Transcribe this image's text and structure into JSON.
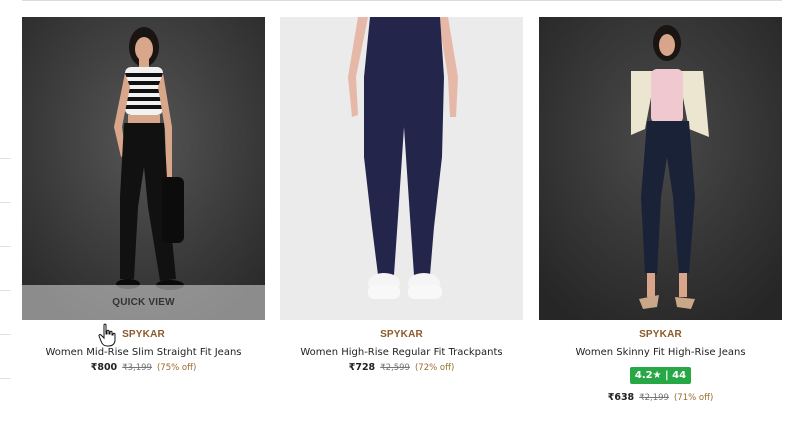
{
  "products": [
    {
      "brand": "SPYKAR",
      "title": "Women Mid-Rise Slim Straight Fit Jeans",
      "price": "₹800",
      "mrp": "₹3,199",
      "discount": "(75% off)",
      "quick_view": "QUICK VIEW",
      "colors": {
        "bg": "#3a3a3a",
        "top": "#f2f2f2",
        "bottom": "#111111"
      }
    },
    {
      "brand": "SPYKAR",
      "title": "Women High-Rise Regular Fit Trackpants",
      "price": "₹728",
      "mrp": "₹2,599",
      "discount": "(72% off)",
      "colors": {
        "bg": "#ebebeb",
        "bottom": "#23264a"
      }
    },
    {
      "brand": "SPYKAR",
      "title": "Women Skinny Fit High-Rise Jeans",
      "rating": "4.2★ | 44",
      "price": "₹638",
      "mrp": "₹2,199",
      "discount": "(71% off)",
      "colors": {
        "bg": "#333333",
        "top": "#f0c9d0",
        "bottom": "#1a2238"
      }
    }
  ],
  "colors": {
    "brand": "#8a5a2b",
    "rating_bg": "#27a745",
    "discount": "#9a6b2c"
  }
}
